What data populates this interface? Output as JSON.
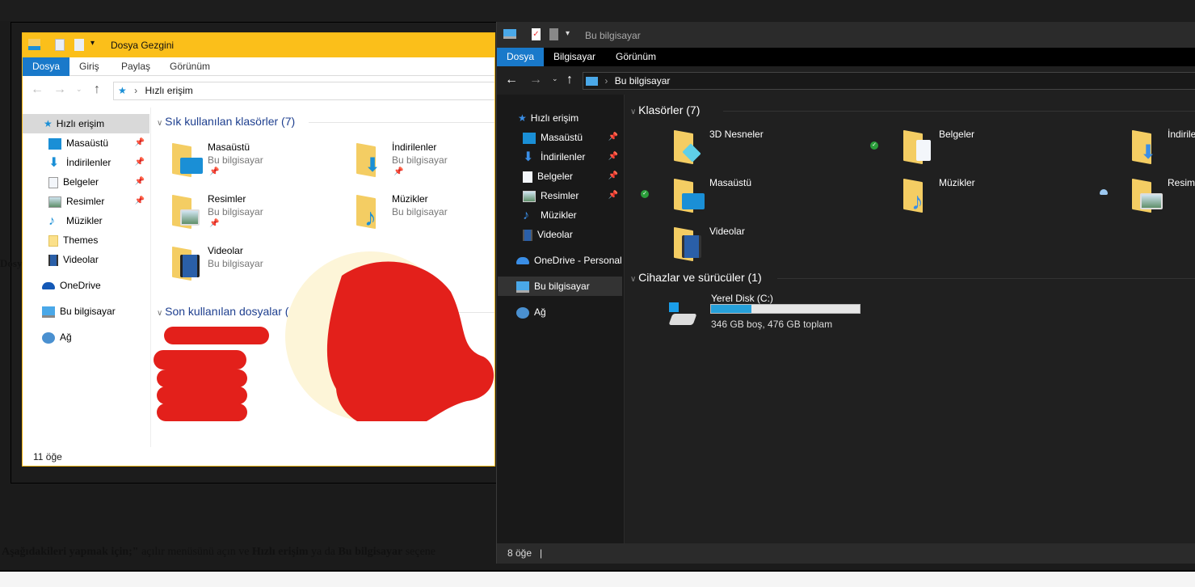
{
  "light_window": {
    "title": "Dosya Gezgini",
    "tabs": [
      "Dosya",
      "Giriş",
      "Paylaş",
      "Görünüm"
    ],
    "address": "Hızlı erişim",
    "sidebar": [
      {
        "label": "Hızlı erişim",
        "icon": "quick-access-star-icon"
      },
      {
        "label": "Masaüstü",
        "icon": "desktop-icon",
        "pinned": true
      },
      {
        "label": "İndirilenler",
        "icon": "downloads-icon",
        "pinned": true
      },
      {
        "label": "Belgeler",
        "icon": "documents-icon",
        "pinned": true
      },
      {
        "label": "Resimler",
        "icon": "pictures-icon",
        "pinned": true
      },
      {
        "label": "Müzikler",
        "icon": "music-icon"
      },
      {
        "label": "Themes",
        "icon": "folder-icon"
      },
      {
        "label": "Videolar",
        "icon": "videos-icon"
      },
      {
        "label": "OneDrive",
        "icon": "onedrive-icon"
      },
      {
        "label": "Bu bilgisayar",
        "icon": "this-pc-icon"
      },
      {
        "label": "Ağ",
        "icon": "network-icon"
      }
    ],
    "frequent_header": "Sık kullanılan klasörler (7)",
    "frequent": [
      {
        "name": "Masaüstü",
        "sub": "Bu bilgisayar",
        "pinned": true
      },
      {
        "name": "İndirilenler",
        "sub": "Bu bilgisayar",
        "pinned": true
      },
      {
        "name": "Resimler",
        "sub": "Bu bilgisayar",
        "pinned": true
      },
      {
        "name": "Müzikler",
        "sub": "Bu bilgisayar"
      },
      {
        "name": "Videolar",
        "sub": "Bu bilgisayar"
      }
    ],
    "recent_header": "Son kullanılan dosyalar (4)",
    "status": "11 öğe",
    "accent": "#fbbf1a"
  },
  "dark_window": {
    "title": "Bu bilgisayar",
    "tabs": [
      "Dosya",
      "Bilgisayar",
      "Görünüm"
    ],
    "address": "Bu bilgisayar",
    "sidebar": [
      {
        "label": "Hızlı erişim"
      },
      {
        "label": "Masaüstü",
        "pinned": true
      },
      {
        "label": "İndirilenler",
        "pinned": true
      },
      {
        "label": "Belgeler",
        "pinned": true
      },
      {
        "label": "Resimler",
        "pinned": true
      },
      {
        "label": "Müzikler"
      },
      {
        "label": "Videolar"
      },
      {
        "label": "OneDrive - Personal"
      },
      {
        "label": "Bu bilgisayar",
        "selected": true
      },
      {
        "label": "Ağ"
      }
    ],
    "folders_header": "Klasörler (7)",
    "folders": [
      "3D Nesneler",
      "Belgeler",
      "İndirilenler",
      "Masaüstü",
      "Müzikler",
      "Resimler",
      "Videolar"
    ],
    "devices_header": "Cihazlar ve sürücüler (1)",
    "disk": {
      "name": "Yerel Disk (C:)",
      "info": "346 GB boş, 476 GB toplam",
      "used_fraction": 0.27
    },
    "status": "8 öğe"
  },
  "page_text": {
    "b1": "Aşağıdakileri yapmak için;\"",
    "t1": " açılır menüsünü açın ve ",
    "b2": "Hızlı erişim",
    "t2": " ya da ",
    "b3": "Bu bilgisayar",
    "t3": " seçene",
    "left_fragment": "Dosy"
  }
}
